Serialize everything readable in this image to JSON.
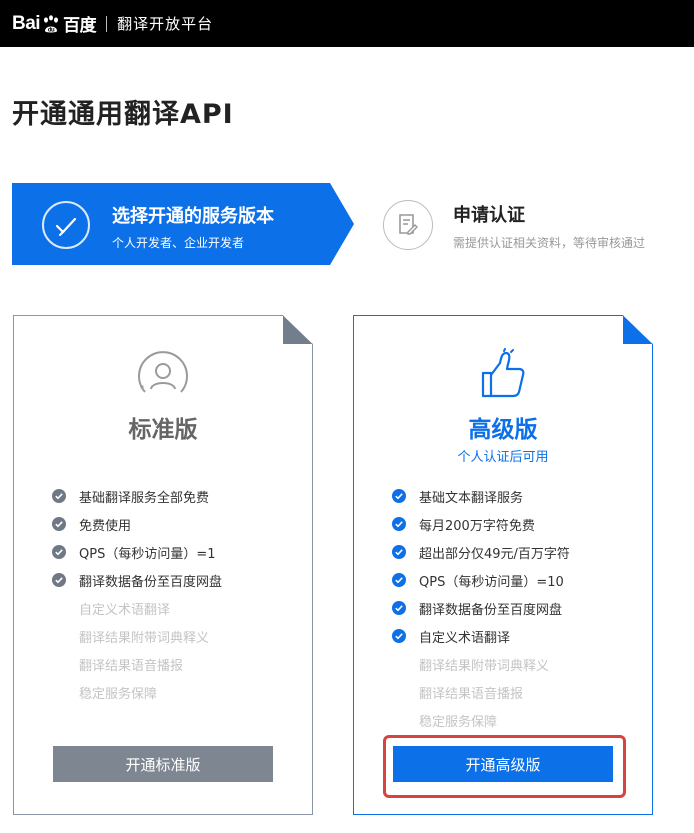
{
  "header": {
    "logo_text_left": "Bai",
    "logo_text_right": "百度",
    "platform_name": "翻译开放平台"
  },
  "page": {
    "title": "开通通用翻译API"
  },
  "steps": [
    {
      "title": "选择开通的服务版本",
      "subtitle": "个人开发者、企业开发者",
      "active": true,
      "icon": "check-circle-icon"
    },
    {
      "title": "申请认证",
      "subtitle": "需提供认证相关资料，等待审核通过",
      "active": false,
      "icon": "document-edit-icon"
    }
  ],
  "plans": {
    "standard": {
      "title": "标准版",
      "icon": "user-icon",
      "features_included": [
        "基础翻译服务全部免费",
        "免费使用",
        "QPS（每秒访问量）=1",
        "翻译数据备份至百度网盘"
      ],
      "features_excluded": [
        "自定义术语翻译",
        "翻译结果附带词典释义",
        "翻译结果语音播报",
        "稳定服务保障"
      ],
      "button_label": "开通标准版"
    },
    "premium": {
      "title": "高级版",
      "subtitle": "个人认证后可用",
      "icon": "thumbs-up-icon",
      "features_included": [
        "基础文本翻译服务",
        "每月200万字符免费",
        "超出部分仅49元/百万字符",
        "QPS（每秒访问量）=10",
        "翻译数据备份至百度网盘",
        "自定义术语翻译"
      ],
      "features_excluded": [
        "翻译结果附带词典释义",
        "翻译结果语音播报",
        "稳定服务保障"
      ],
      "button_label": "开通高级版"
    }
  },
  "colors": {
    "accent": "#0c70e8",
    "header_bg": "#000000",
    "disabled_button": "#7d8691",
    "highlight": "#d7433f"
  }
}
